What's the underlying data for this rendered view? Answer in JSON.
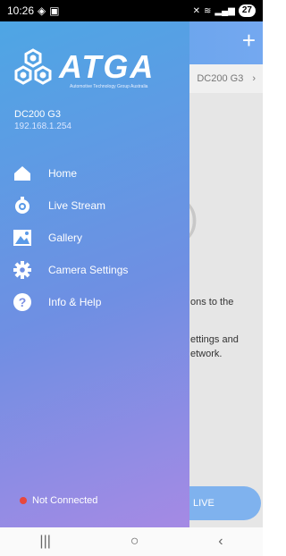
{
  "status": {
    "time": "10:26",
    "battery": "27"
  },
  "background": {
    "device_tab": "DC200 G3",
    "text_line1": "ons to the",
    "text_line2": "ettings and",
    "text_line3": "etwork.",
    "live_label": "LIVE"
  },
  "drawer": {
    "brand": "ATGA",
    "brand_sub": "Automotive Technology Group Australia",
    "device_name": "DC200 G3",
    "device_ip": "192.168.1.254",
    "menu": [
      {
        "label": "Home",
        "icon": "home-icon"
      },
      {
        "label": "Live Stream",
        "icon": "live-stream-icon"
      },
      {
        "label": "Gallery",
        "icon": "gallery-icon"
      },
      {
        "label": "Camera Settings",
        "icon": "gear-icon"
      },
      {
        "label": "Info & Help",
        "icon": "help-icon"
      }
    ],
    "connection_status": "Not Connected",
    "status_color": "#e8473d"
  }
}
